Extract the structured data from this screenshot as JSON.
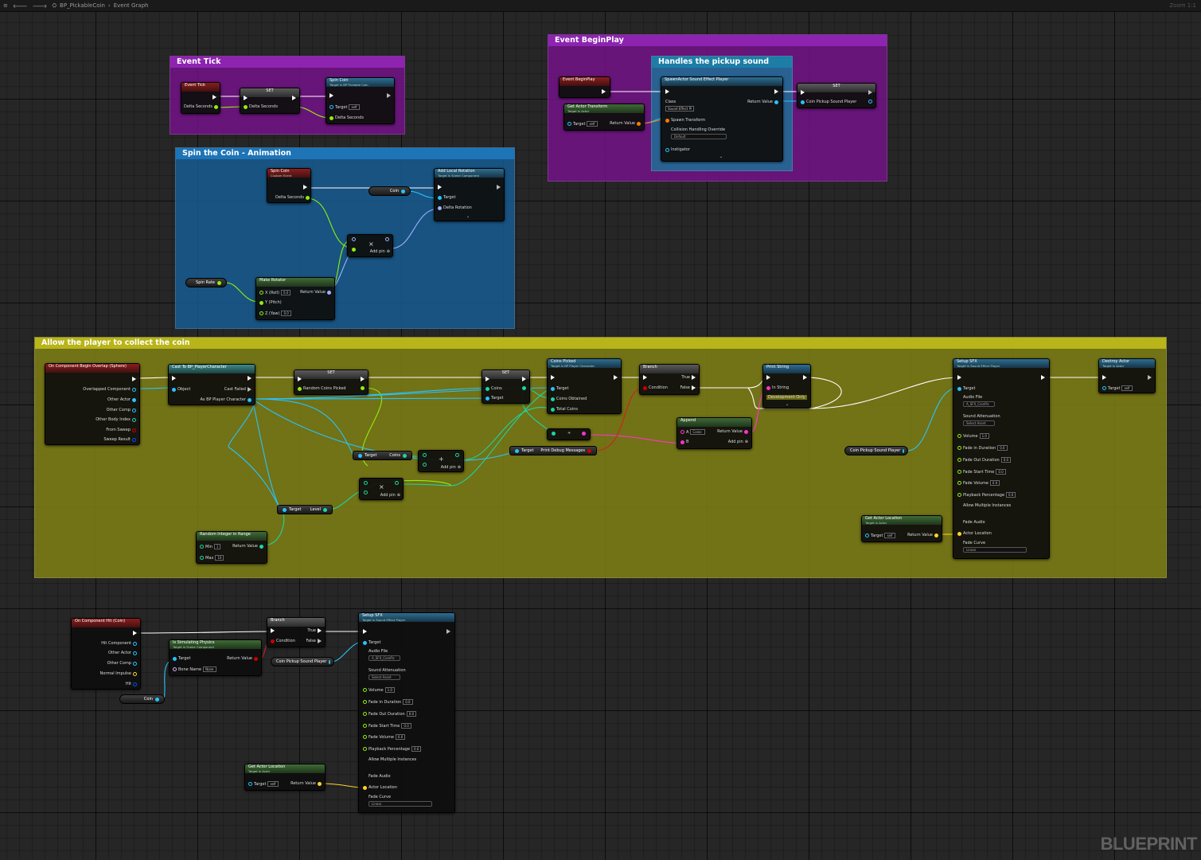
{
  "toolbar": {
    "crumb_blueprint": "BP_PickableCoin",
    "crumb_graph": "Event Graph",
    "zoom": "Zoom 1:1"
  },
  "comments": {
    "event_tick": "Event Tick",
    "spin": "Spin the Coin - Animation",
    "begin_play": "Event BeginPlay",
    "pickup_sound": "Handles the pickup sound",
    "collect": "Allow the player to collect the coin"
  },
  "watermark": "BLUEPRINT",
  "colors": {
    "exec": "#ffffff",
    "object": "#27c3ff",
    "float": "#8ff00b",
    "rotator": "#9db3ff",
    "string": "#ff33cc",
    "bool": "#cc0000",
    "vector": "#ffd22b",
    "int": "#1ed6a0",
    "struct_pin": "#ff7a00"
  },
  "n_eventtick": {
    "title": "Event Tick",
    "p1": "Delta Seconds"
  },
  "n_set1": {
    "title": "SET",
    "p1": "Delta Seconds"
  },
  "n_spincall": {
    "title": "Spin Coin",
    "sub": "Target is BP Pickable Coin",
    "p1": "Target",
    "p1v": "self",
    "p2": "Delta Seconds"
  },
  "n_spinevent": {
    "title": "Spin Coin",
    "sub": "Custom Event",
    "p1": "Delta Seconds"
  },
  "n_coinvar": {
    "label": "Coin"
  },
  "n_addrot": {
    "title": "Add Local Rotation",
    "sub": "Target is Scene Component",
    "p1": "Target",
    "p2": "Delta Rotation"
  },
  "n_mul": {
    "symbol": "×",
    "addpin": "Add pin"
  },
  "n_spinrate": {
    "label": "Spin Rate"
  },
  "n_makerot": {
    "title": "Make Rotator",
    "p1": "X (Roll)",
    "p1v": "0.0",
    "p2": "Y (Pitch)",
    "p3": "Z (Yaw)",
    "p3v": "0.0",
    "ret": "Return Value"
  },
  "n_beginplay": {
    "title": "Event BeginPlay"
  },
  "n_getxform": {
    "title": "Get Actor Transform",
    "sub": "Target is Actor",
    "p1": "Target",
    "p1v": "self",
    "ret": "Return Value"
  },
  "n_spawnsfx": {
    "title": "SpawnActor Sound Effect Player",
    "p1": "Class",
    "p1v": "Sound Effect Pl",
    "p2": "Spawn Transform",
    "p3": "Collision Handling Override",
    "p3v": "Default",
    "p4": "Instigator",
    "ret": "Return Value"
  },
  "n_set2": {
    "title": "SET",
    "p1": "Coin Pickup Sound Player"
  },
  "n_overlap": {
    "title": "On Component Begin Overlap (Sphere)",
    "pins": [
      "Overlapped Component",
      "Other Actor",
      "Other Comp",
      "Other Body Index",
      "From Sweep",
      "Sweep Result"
    ]
  },
  "n_cast": {
    "title": "Cast To BP_PlayerCharacter",
    "p1": "Object",
    "p2": "Cast Failed",
    "p3": "As BP Player Character"
  },
  "n_set3": {
    "title": "SET",
    "p1": "Random Coins Picked"
  },
  "n_set4": {
    "title": "SET",
    "p1": "Coins",
    "p2": "Target"
  },
  "n_coinspicked": {
    "title": "Coins Picked",
    "sub": "Target is BP Player Character",
    "p1": "Target",
    "p2": "Coins Obtained",
    "p3": "Total Coins"
  },
  "n_branch1": {
    "title": "Branch",
    "p1": "Condition",
    "t": "True",
    "f": "False"
  },
  "n_print": {
    "title": "Print String",
    "p1": "In String",
    "p2": "Development Only"
  },
  "n_setupsfx1": {
    "title": "Setup SFX",
    "sub": "Target is Sound Effect Player",
    "p_target": "Target",
    "p_audio": "Audio File",
    "p_audio_v": "A_SFX_CoinPic",
    "p_att": "Sound Attenuation",
    "p_att_v": "Select Asset",
    "p_vol": "Volume",
    "p_vol_v": "1.0",
    "p_fin": "Fade in Duration",
    "p_fin_v": "0.0",
    "p_fout": "Fade Out Duration",
    "p_fout_v": "0.0",
    "p_fst": "Fade Start Time",
    "p_fst_v": "0.0",
    "p_fvol": "Fade Volume",
    "p_fvol_v": "0.0",
    "p_pb": "Playback Percentage",
    "p_pb_v": "0.0",
    "p_multi": "Allow Multiple Instances",
    "p_fa": "Fade Audio",
    "p_loc": "Actor Location",
    "p_fc": "Fade Curve",
    "p_fc_v": "Linear"
  },
  "n_destroy": {
    "title": "Destroy Actor",
    "sub": "Target is Actor",
    "p1": "Target",
    "p1v": "self"
  },
  "n_append": {
    "title": "Append",
    "a": "A",
    "av": "Coins: ",
    "b": "B",
    "ret": "Return Value",
    "addpin": "Add pin"
  },
  "n_plus": {
    "symbol": "+"
  },
  "n_targetcoins": {
    "a": "Target",
    "b": "Coins"
  },
  "n_printdebug": {
    "a": "Target",
    "b": "Print Debug Messages"
  },
  "n_add": {
    "symbol": "+",
    "addpin": "Add pin"
  },
  "n_mul2": {
    "symbol": "×",
    "addpin": "Add pin"
  },
  "n_targetlevel": {
    "a": "Target",
    "b": "Level"
  },
  "n_randint": {
    "title": "Random Integer in Range",
    "p1": "Min",
    "p1v": "1",
    "p2": "Max",
    "p2v": "10",
    "ret": "Return Value"
  },
  "n_coinsfxvar": {
    "label": "Coin Pickup Sound Player"
  },
  "n_getloc1": {
    "title": "Get Actor Location",
    "sub": "Target is Actor",
    "p1": "Target",
    "p1v": "self",
    "ret": "Return Value"
  },
  "n_hit": {
    "title": "On Component Hit (Coin)",
    "pins": [
      "Hit Component",
      "Other Actor",
      "Other Comp",
      "Normal Impulse",
      "Hit"
    ]
  },
  "n_coinvar2": {
    "label": "Coin"
  },
  "n_simphys": {
    "title": "Is Simulating Physics",
    "sub": "Target is Scene Component",
    "p1": "Target",
    "p2": "Bone Name",
    "p2v": "None",
    "ret": "Return Value"
  },
  "n_branch2": {
    "title": "Branch",
    "p1": "Condition",
    "t": "True",
    "f": "False"
  },
  "n_coinsfxvar2": {
    "label": "Coin Pickup Sound Player"
  },
  "n_getloc2": {
    "title": "Get Actor Location",
    "sub": "Target is Actor",
    "p1": "Target",
    "p1v": "self",
    "ret": "Return Value"
  }
}
